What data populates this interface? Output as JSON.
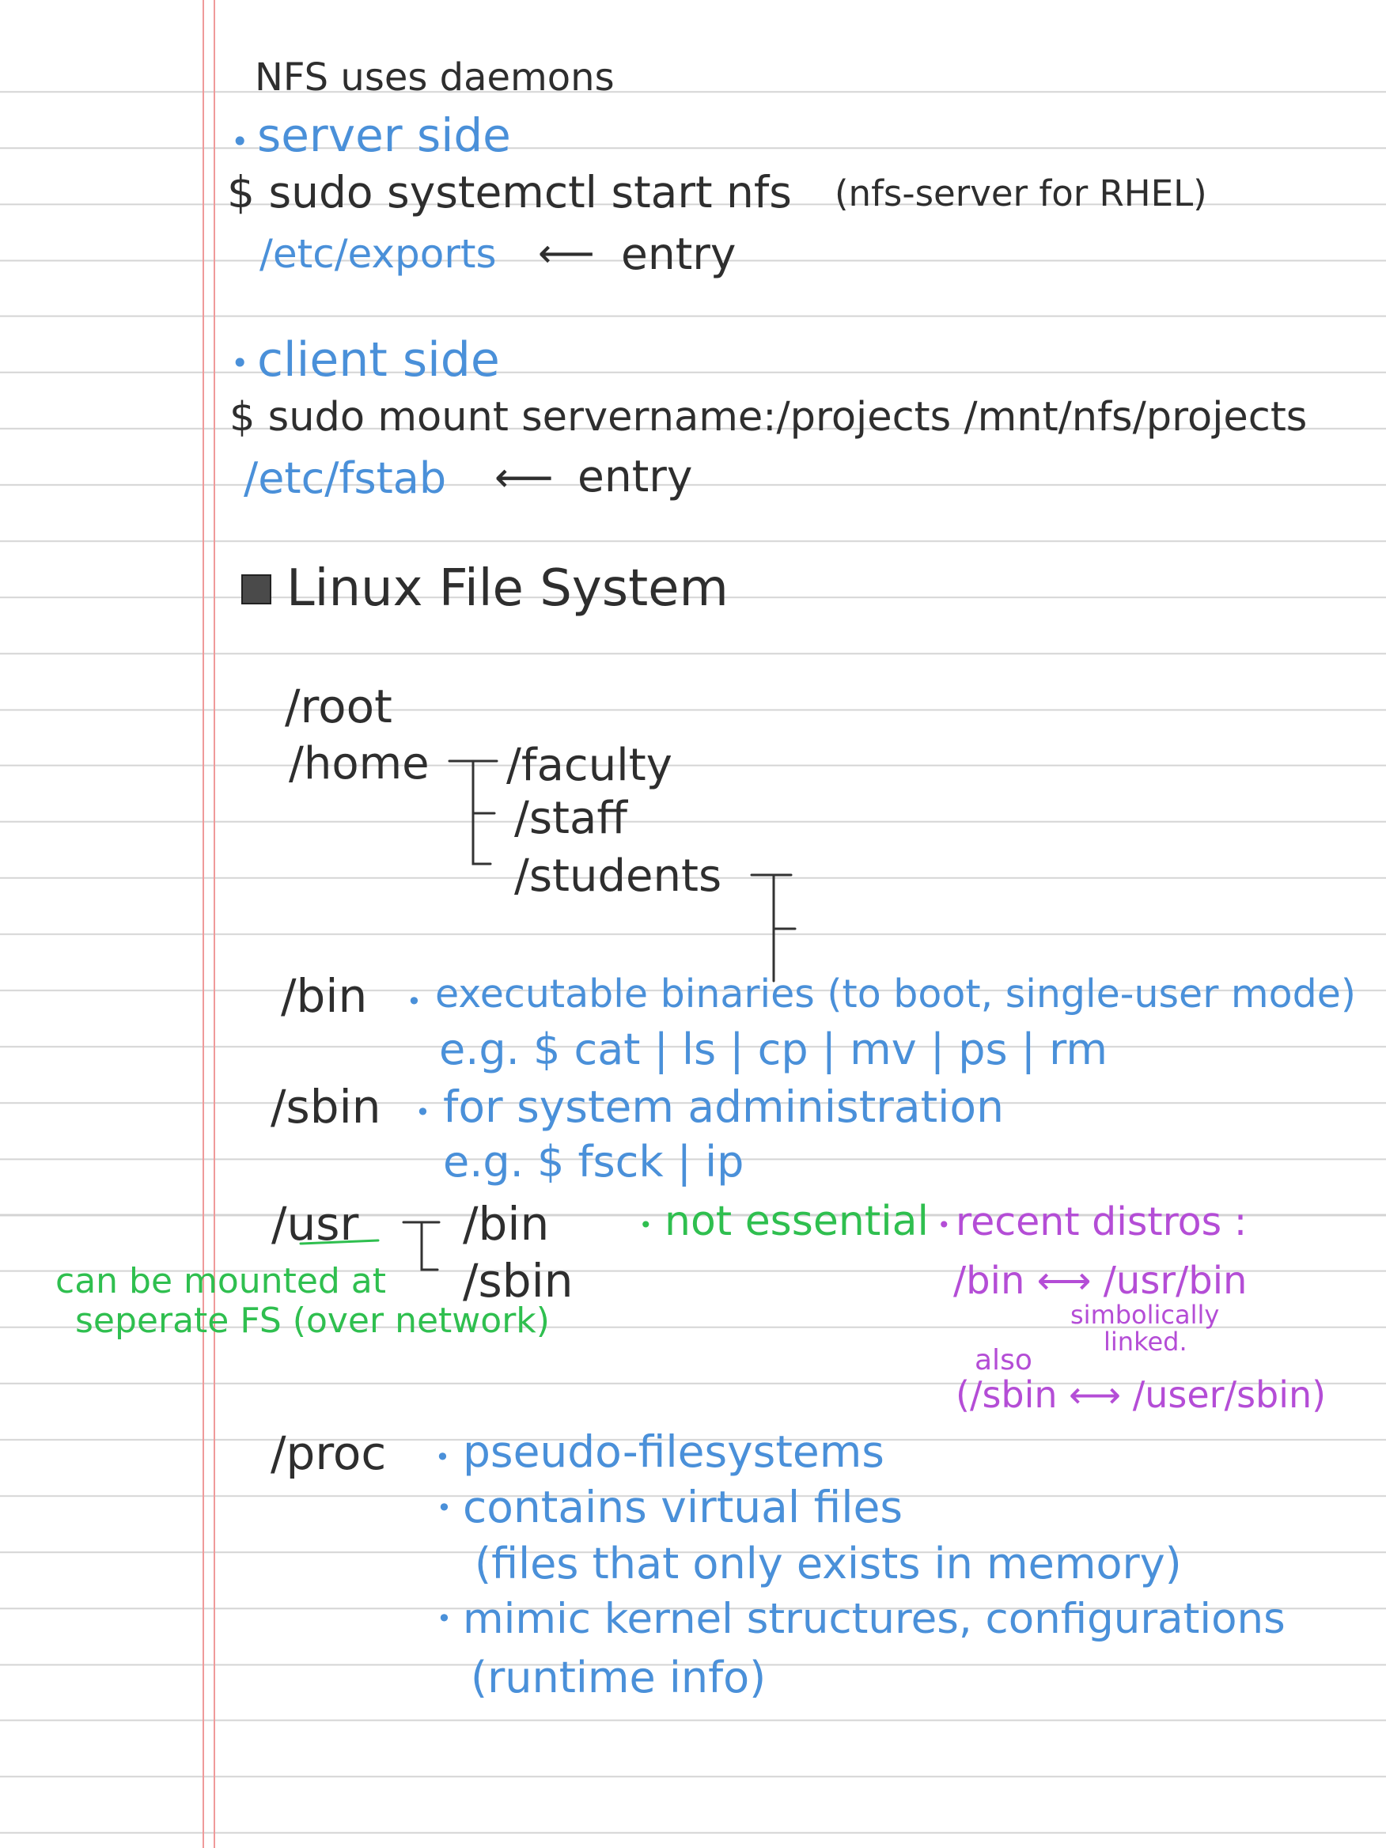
{
  "notes": {
    "title": "NFS uses daemons",
    "server": {
      "heading": "server side",
      "command": "$ sudo systemctl start nfs",
      "note": "(nfs-server for RHEL)",
      "config_file": "/etc/exports",
      "config_label": "entry"
    },
    "client": {
      "heading": "client side",
      "command": "$ sudo mount servername:/projects /mnt/nfs/projects",
      "config_file": "/etc/fstab",
      "config_label": "entry"
    },
    "fs_heading": "Linux File System",
    "tree": {
      "root": "/root",
      "home": "/home",
      "faculty": "/faculty",
      "staff": "/staff",
      "students": "/students"
    },
    "bin": {
      "path": "/bin",
      "desc": "executable binaries (to boot, single-user mode)",
      "example": "e.g. $ cat | ls | cp | mv | ps | rm"
    },
    "sbin": {
      "path": "/sbin",
      "desc": "for system administration",
      "example": "e.g. $ fsck | ip"
    },
    "usr": {
      "path": "/usr",
      "bin": "/bin",
      "sbin": "/sbin",
      "green_note": "not essential",
      "green_mount_1": "can be mounted at",
      "green_mount_2": "seperate FS (over network)",
      "purple_heading": "recent distros :",
      "purple_link1": "/bin ⟷ /usr/bin",
      "purple_sym1": "simbolically",
      "purple_sym2": "linked.",
      "purple_also": "also",
      "purple_link2": "(/sbin ⟷ /user/sbin)"
    },
    "proc": {
      "path": "/proc",
      "b1": "pseudo-filesystems",
      "b2": "contains virtual files",
      "b2_sub": "(files that only exists in memory)",
      "b3": "mimic kernel structures, configurations",
      "b3_sub": "(runtime info)"
    }
  }
}
